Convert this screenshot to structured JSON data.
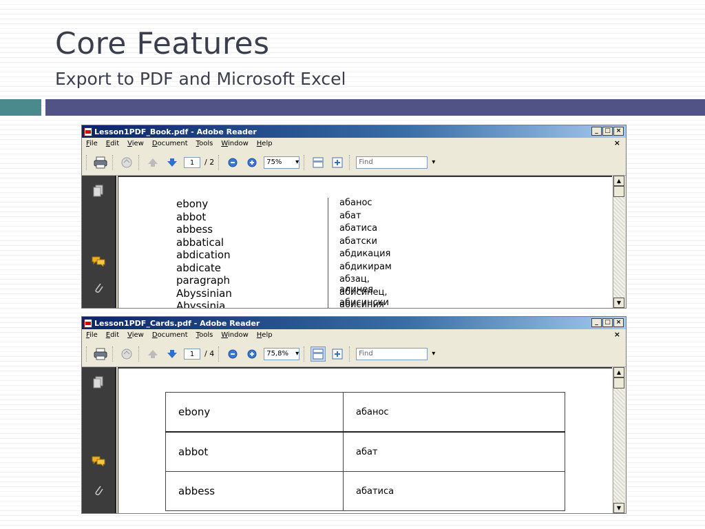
{
  "slide": {
    "title": "Core Features",
    "subtitle": "Export to PDF and Microsoft Excel"
  },
  "colors": {
    "accent_teal": "#4a8a8c",
    "accent_purple": "#515386",
    "title_bar": "#0a246a"
  },
  "menu": [
    "File",
    "Edit",
    "View",
    "Document",
    "Tools",
    "Window",
    "Help"
  ],
  "window1": {
    "title": "Lesson1PDF_Book.pdf - Adobe Reader",
    "page_current": "1",
    "page_total": "/ 2",
    "zoom": "75%",
    "find_placeholder": "Find",
    "entries": [
      {
        "en": "ebony",
        "ru": "абанос"
      },
      {
        "en": "abbot",
        "ru": "абат"
      },
      {
        "en": "abbess",
        "ru": "абатиса"
      },
      {
        "en": "abbatical",
        "ru": "абатски"
      },
      {
        "en": "abdication",
        "ru": "абдикация"
      },
      {
        "en": "abdicate",
        "ru": "абдикирам"
      },
      {
        "en": "paragraph",
        "ru": "абзац, алинея"
      },
      {
        "en": "Abyssinian",
        "ru": "абисинец, абисински"
      },
      {
        "en": "Abyssinia",
        "ru": "абисиния"
      }
    ]
  },
  "window2": {
    "title": "Lesson1PDF_Cards.pdf - Adobe Reader",
    "page_current": "1",
    "page_total": "/ 4",
    "zoom": "75,8%",
    "find_placeholder": "Find",
    "cards": [
      {
        "en": "ebony",
        "ru": "абанос"
      },
      {
        "en": "abbot",
        "ru": "абат"
      },
      {
        "en": "abbess",
        "ru": "абатиса"
      }
    ]
  }
}
